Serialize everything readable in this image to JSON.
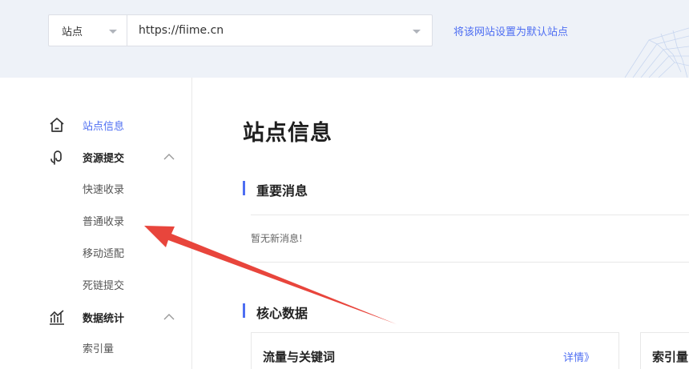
{
  "site_selector": {
    "type_value": "站点",
    "url_value": "https://fiime.cn",
    "set_default_link": "将该网站设置为默认站点"
  },
  "sidebar": {
    "items": [
      {
        "label": "站点信息",
        "icon": "home-icon",
        "active": true
      },
      {
        "label": "资源提交",
        "icon": "submit-icon",
        "expanded": true,
        "children": [
          "快速收录",
          "普通收录",
          "移动适配",
          "死链提交"
        ]
      },
      {
        "label": "数据统计",
        "icon": "chart-icon",
        "expanded": true,
        "children": [
          "索引量"
        ]
      }
    ]
  },
  "main": {
    "title": "站点信息",
    "important_section": {
      "title": "重要消息",
      "empty_text": "暂无新消息!"
    },
    "core_section": {
      "title": "核心数据",
      "cards": [
        {
          "title": "流量与关键词",
          "link": "详情》"
        },
        {
          "title": "索引量"
        }
      ]
    }
  },
  "colors": {
    "accent": "#4e6ef2",
    "annotation_arrow": "#e8453c",
    "banner_bg": "#eef2f8"
  }
}
